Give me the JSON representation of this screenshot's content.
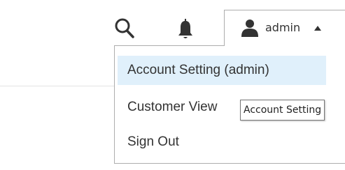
{
  "header": {
    "search_icon": "search-icon",
    "notifications_icon": "bell-icon",
    "account": {
      "user_icon": "user-icon",
      "name": "admin",
      "caret_icon": "caret-up-icon"
    }
  },
  "account_menu": {
    "items": [
      {
        "label": "Account Setting (admin)",
        "highlighted": true
      },
      {
        "label": "Customer View"
      },
      {
        "label": "Sign Out"
      }
    ]
  },
  "tooltip": {
    "text": "Account Setting"
  },
  "colors": {
    "highlight": "#e0f0fb",
    "border": "#adadad",
    "text": "#333333"
  }
}
